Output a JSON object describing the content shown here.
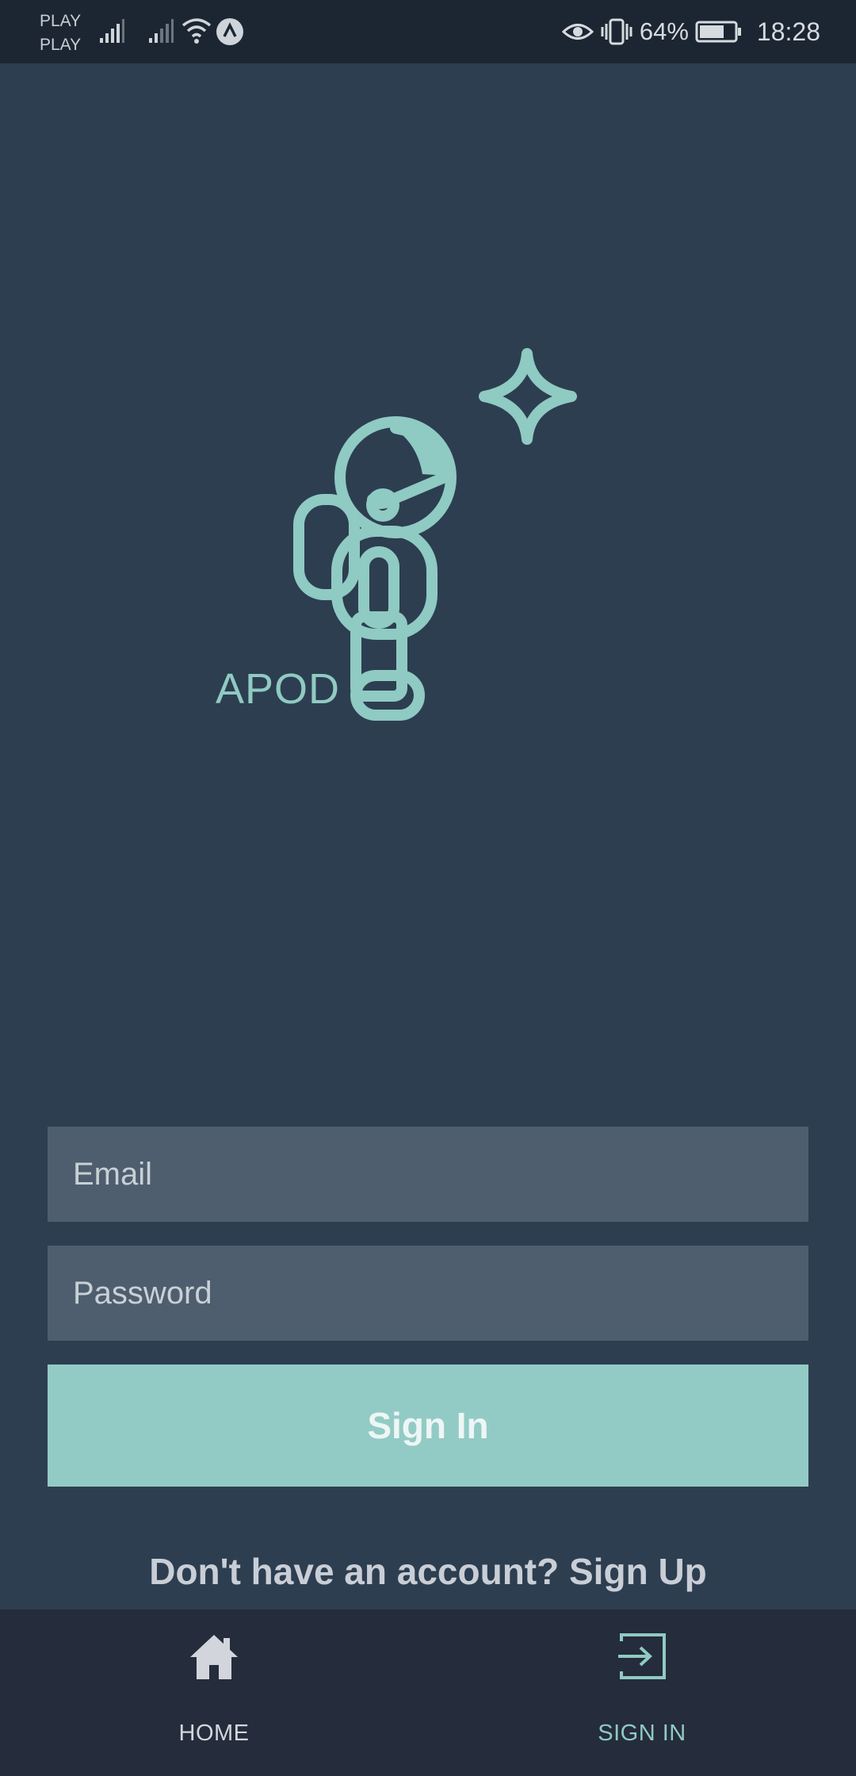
{
  "status_bar": {
    "carrier_1": "PLAY",
    "carrier_2": "PLAY",
    "battery_percent": "64%",
    "time": "18:28",
    "icons": [
      "signal-icon",
      "signal-icon",
      "wifi-icon",
      "app-notification-icon",
      "eye-icon",
      "vibrate-icon",
      "battery-icon"
    ]
  },
  "logo": {
    "text": "APOD",
    "icon": "astronaut-icon",
    "accent_color": "#8fcac3"
  },
  "form": {
    "email_placeholder": "Email",
    "password_placeholder": "Password",
    "signin_label": "Sign In",
    "signup_prompt": "Don't have an account? Sign Up"
  },
  "bottom_nav": {
    "items": [
      {
        "label": "HOME",
        "icon": "home-icon",
        "active": false
      },
      {
        "label": "SIGN IN",
        "icon": "sign-in-icon",
        "active": true
      }
    ]
  },
  "colors": {
    "background": "#2d3e50",
    "field": "#4e5e6e",
    "button": "#92cbc5",
    "nav_bg": "#252c3b"
  }
}
